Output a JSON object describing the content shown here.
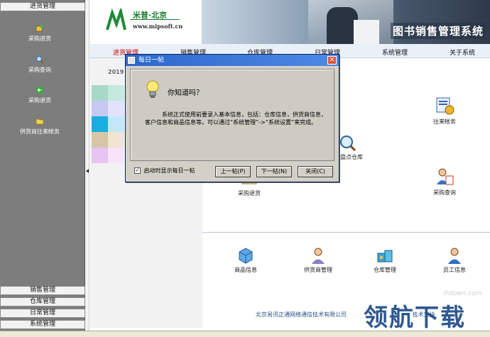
{
  "sidebar": {
    "top_group": "进货管理",
    "items": [
      {
        "label": "采购进货",
        "icon": "purchase-in-icon"
      },
      {
        "label": "采购查询",
        "icon": "search-icon"
      },
      {
        "label": "采购退货",
        "icon": "return-arrow-icon"
      },
      {
        "label": "供货商往来帐务",
        "icon": "folder-icon"
      }
    ],
    "bottom_groups": [
      "销售管理",
      "仓库管理",
      "日常管理",
      "系统管理"
    ]
  },
  "header": {
    "logo_brand": "米普·北京",
    "logo_url": "www.mipsoft.cn",
    "banner_title": "图书销售管理系统"
  },
  "nav": {
    "items": [
      "进货管理",
      "销售管理",
      "仓库管理",
      "日常管理",
      "系统管理",
      "关于系统"
    ],
    "active": "进货管理",
    "active_color": "#cc0000"
  },
  "calendar": {
    "year_partial": "2019"
  },
  "main": {
    "upper_icons": [
      {
        "label": "往来帐务",
        "icon": "accounts-icon"
      },
      {
        "label": "盘点仓库",
        "icon": "warehouse-check-icon"
      },
      {
        "label": "采购退货",
        "icon": "purchase-return-icon"
      },
      {
        "label": "采购查询",
        "icon": "purchase-search-icon"
      }
    ],
    "lower_icons": [
      {
        "label": "商品信息",
        "icon": "product-info-icon"
      },
      {
        "label": "供货商管理",
        "icon": "supplier-icon"
      },
      {
        "label": "仓库管理",
        "icon": "warehouse-icon"
      },
      {
        "label": "员工信息",
        "icon": "employee-icon"
      }
    ],
    "footer_company": "北京易讯正通网络通信技术有限公司",
    "footer_support": "技术支持"
  },
  "dialog": {
    "title": "每日一帖",
    "heading": "你知道吗？",
    "body": "系统正式使用前要录入基本信息，包括：仓库信息，供货商信息，客户信息和商品信息等。可以通过“系统管理”->“系统设置”来完成。",
    "checkbox_label": "启动时显示每日一帖",
    "checkbox_checked": true,
    "prev_label": "上一帖(P)",
    "next_label": "下一帖(N)",
    "close_label": "关闭(C)"
  },
  "watermark": {
    "url": "ihdown.com",
    "text": "领航下载"
  }
}
